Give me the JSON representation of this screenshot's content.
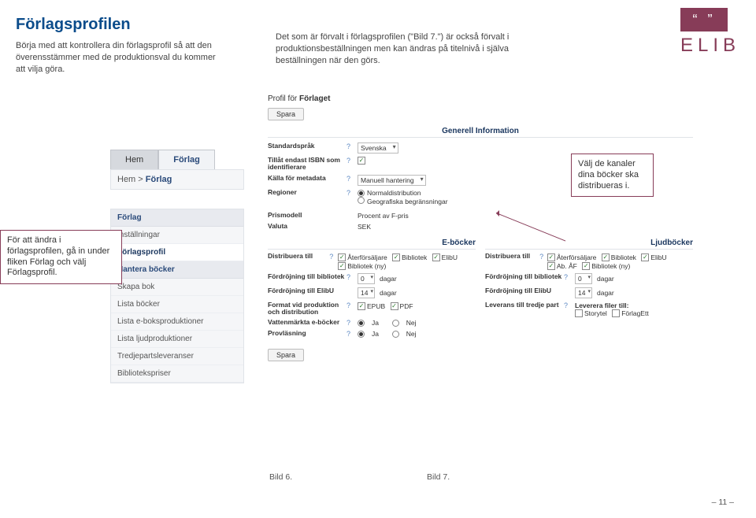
{
  "header": {
    "title": "Förlagsprofilen",
    "intro": "Börja med att kontrollera din förlagsprofil så att den överensstämmer med de produktionsval du kommer att vilja göra.",
    "intro2": "Det som är förvalt i förlagsprofilen (\"Bild 7.\") är också förvalt i produktionsbeställningen men kan ändras på titelnivå i själva beställningen när den görs."
  },
  "logo": {
    "quotes": "“ ”",
    "text": "ELIB"
  },
  "bild6": {
    "tabs": [
      "Hem",
      "Förlag"
    ],
    "breadcrumb_a": "Hem >",
    "breadcrumb_b": "Förlag",
    "menu_groups": [
      {
        "label": "Förlag",
        "items": [
          {
            "label": "Inställningar",
            "active": false
          },
          {
            "label": "Förlagsprofil",
            "active": true
          }
        ]
      },
      {
        "label": "Hantera böcker",
        "items": [
          {
            "label": "Skapa bok"
          },
          {
            "label": "Lista böcker"
          },
          {
            "label": "Lista e-boksproduktioner"
          },
          {
            "label": "Lista ljudproduktioner"
          },
          {
            "label": "Tredjepartsleveranser"
          },
          {
            "label": "Bibliotekspriser"
          }
        ]
      }
    ]
  },
  "bild7": {
    "profile_for": "Profil för",
    "profile_name": "Förlaget",
    "save": "Spara",
    "gen_title": "Generell Information",
    "rows": {
      "standard_lang_label": "Standardspråk",
      "standard_lang_value": "Svenska",
      "isbn_label": "Tillåt endast ISBN som identifierare",
      "metadata_label": "Källa för metadata",
      "metadata_value": "Manuell hantering",
      "regions_label": "Regioner",
      "regions_opts": [
        "Normaldistribution",
        "Geografiska begränsningar"
      ],
      "pricemodel_label": "Prismodell",
      "pricemodel_value": "Procent av F-pris",
      "valuta_label": "Valuta",
      "valuta_value": "SEK"
    },
    "eb": {
      "title": "E-böcker",
      "dist_label": "Distribuera till",
      "dist_opts": [
        "Återförsäljare",
        "Bibliotek",
        "ElibU",
        "Bibliotek (ny)"
      ],
      "dist_checked": [
        true,
        true,
        true,
        true
      ],
      "delay_bib_label": "Fördröjning till bibliotek",
      "delay_bib_val": "0",
      "days": "dagar",
      "delay_elibu_label": "Fördröjning till ElibU",
      "delay_elibu_val": "14",
      "format_label": "Format vid produktion och distribution",
      "format_opts": [
        "EPUB",
        "PDF"
      ],
      "watermark_label": "Vattenmärkta e-böcker",
      "yes": "Ja",
      "no": "Nej",
      "sample_label": "Provläsning"
    },
    "lb": {
      "title": "Ljudböcker",
      "dist_label": "Distribuera till",
      "dist_opts": [
        "Återförsäljare",
        "Bibliotek",
        "ElibU",
        "Ab. ÅF",
        "Bibliotek (ny)"
      ],
      "dist_checked": [
        true,
        true,
        true,
        true,
        true
      ],
      "delay_bib_label": "Fördröjning till bibliotek",
      "delay_bib_val": "0",
      "days": "dagar",
      "delay_elibu_label": "Fördröjning till ElibU",
      "delay_elibu_val": "14",
      "third_label": "Leverans till tredje part",
      "third_head": "Leverera filer till:",
      "third_opts": [
        "Storytel",
        "FörlagEtt"
      ]
    }
  },
  "callouts": {
    "left": "För att ändra i förlagsprofilen, gå in under fliken Förlag och välj Förlagsprofil.",
    "right": "Välj de kanaler dina böcker ska distribueras i."
  },
  "captions": {
    "b6": "Bild 6.",
    "b7": "Bild 7."
  },
  "page": "– 11 –"
}
